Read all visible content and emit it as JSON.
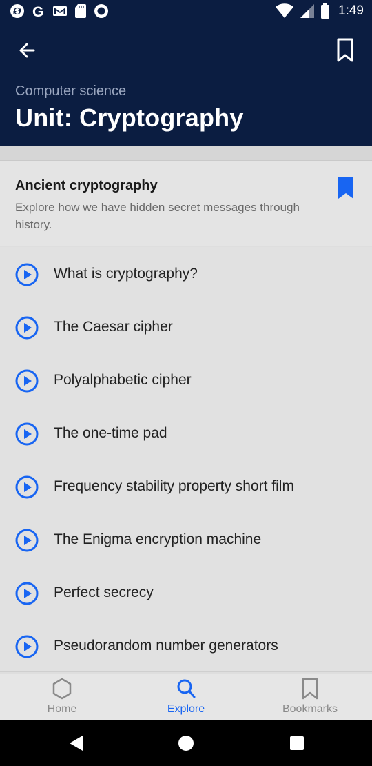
{
  "status_bar": {
    "time": "1:49",
    "left_icons": [
      "sync-icon",
      "google-icon",
      "gmail-icon",
      "sd-card-icon",
      "record-icon"
    ],
    "right_icons": [
      "wifi-icon",
      "signal-icon",
      "battery-icon"
    ]
  },
  "header": {
    "subject": "Computer science",
    "title": "Unit: Cryptography",
    "background": "#0b1d41"
  },
  "lesson": {
    "title": "Ancient cryptography",
    "description": "Explore how we have hidden secret messages through history.",
    "bookmarked": true
  },
  "items": [
    {
      "label": "What is cryptography?"
    },
    {
      "label": "The Caesar cipher"
    },
    {
      "label": "Polyalphabetic cipher"
    },
    {
      "label": "The one-time pad"
    },
    {
      "label": "Frequency stability property short film"
    },
    {
      "label": "The Enigma encryption machine"
    },
    {
      "label": "Perfect secrecy"
    },
    {
      "label": "Pseudorandom number generators"
    }
  ],
  "bottom_nav": {
    "tabs": [
      {
        "label": "Home",
        "icon": "hexagon-icon",
        "active": false
      },
      {
        "label": "Explore",
        "icon": "search-icon",
        "active": true
      },
      {
        "label": "Bookmarks",
        "icon": "bookmark-icon",
        "active": false
      }
    ]
  },
  "colors": {
    "accent": "#1865f2",
    "header_bg": "#0b1d41",
    "list_bg": "#e1e1e1"
  }
}
